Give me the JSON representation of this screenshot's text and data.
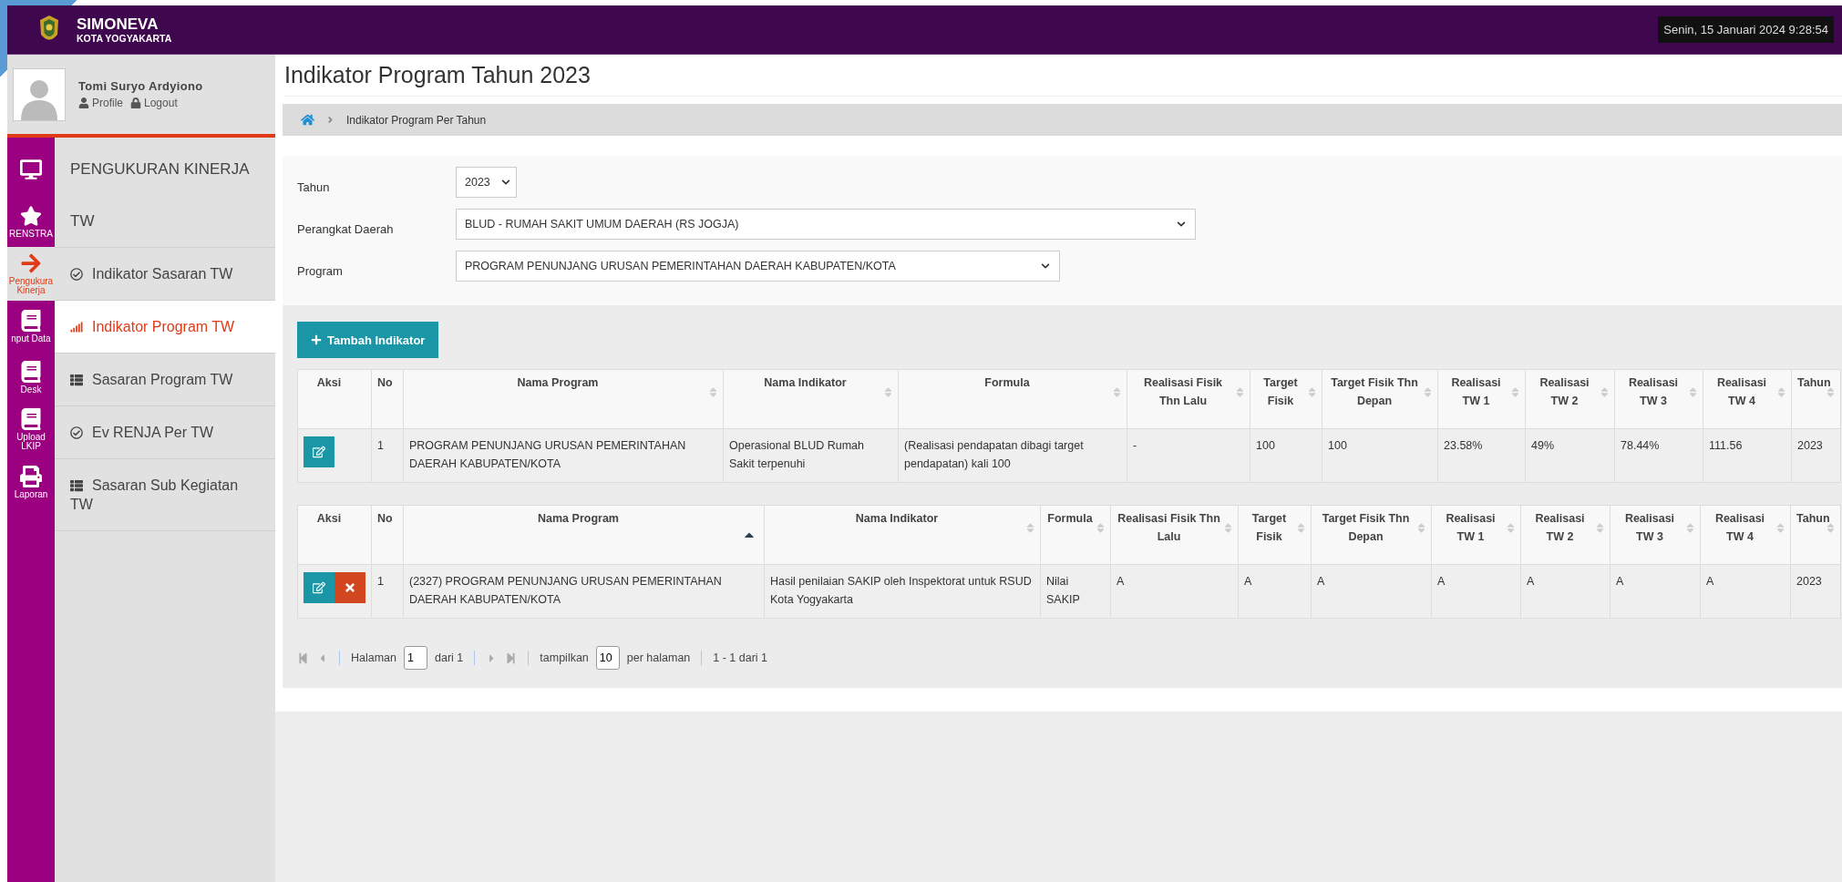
{
  "header": {
    "title": "SIMONEVA",
    "subtitle": "KOTA YOGYAKARTA",
    "datetime": "Senin, 15 Januari 2024  9:28:54"
  },
  "user": {
    "name": "Tomi Suryo Ardyiono",
    "links": [
      {
        "kind": "person",
        "label": "Profile"
      },
      {
        "kind": "lock",
        "label": "Logout"
      }
    ]
  },
  "rail": [
    {
      "kind": "monitor",
      "selected": false
    },
    {
      "kind": "star",
      "lines": [
        "RENSTRA"
      ],
      "selected": false
    },
    {
      "kind": "arrow",
      "lines": [
        "Pengukura",
        "Kinerja"
      ],
      "selected": true
    },
    {
      "kind": "book",
      "lines": [
        "nput Data"
      ],
      "selected": false
    },
    {
      "kind": "book",
      "lines": [
        "Desk"
      ],
      "selected": false
    },
    {
      "kind": "book",
      "lines": [
        "Upload",
        "LKIP"
      ],
      "selected": false
    },
    {
      "kind": "printer",
      "lines": [
        "Laporan"
      ],
      "selected": false
    }
  ],
  "menu": {
    "heading": [
      "PENGUKURAN KINERJA",
      "TW"
    ],
    "items": [
      {
        "kind": "check",
        "label": "Indikator Sasaran TW",
        "selected": false
      },
      {
        "kind": "signal",
        "label": "Indikator Program TW",
        "selected": true
      },
      {
        "kind": "list",
        "label": "Sasaran Program TW",
        "selected": false
      },
      {
        "kind": "check",
        "label": "Ev RENJA Per TW",
        "selected": false
      },
      {
        "kind": "list",
        "label": "Sasaran Sub Kegiatan TW",
        "selected": false
      }
    ]
  },
  "page": {
    "title": "Indikator Program Tahun 2023",
    "breadcrumb": [
      "Indikator Program Per Tahun"
    ]
  },
  "filters": [
    {
      "label": "Tahun",
      "value": "2023"
    },
    {
      "label": "Perangkat Daerah",
      "value": "BLUD - RUMAH SAKIT UMUM DAERAH (RS JOGJA)"
    },
    {
      "label": "Program",
      "value": "PROGRAM PENUNJANG URUSAN PEMERINTAHAN DAERAH KABUPATEN/KOTA"
    }
  ],
  "add_button": "Tambah Indikator",
  "tables": [
    {
      "columns": [
        {
          "label": "Aksi",
          "sortable": false,
          "sorted": false
        },
        {
          "label": "No",
          "sortable": false,
          "sorted": false
        },
        {
          "label": "Nama Program",
          "sortable": true,
          "sorted": false
        },
        {
          "label": "Nama Indikator",
          "sortable": true,
          "sorted": false
        },
        {
          "label": "Formula",
          "sortable": true,
          "sorted": false
        },
        {
          "label": "Realisasi Fisik Thn Lalu",
          "sortable": true,
          "sorted": false
        },
        {
          "label": "Target Fisik",
          "sortable": true,
          "sorted": false
        },
        {
          "label": "Target Fisik Thn Depan",
          "sortable": true,
          "sorted": false
        },
        {
          "label": "Realisasi TW 1",
          "sortable": true,
          "sorted": false
        },
        {
          "label": "Realisasi TW 2",
          "sortable": true,
          "sorted": false
        },
        {
          "label": "Realisasi TW 3",
          "sortable": true,
          "sorted": false
        },
        {
          "label": "Realisasi TW 4",
          "sortable": true,
          "sorted": false
        },
        {
          "label": "Tahun",
          "sortable": true,
          "sorted": false
        }
      ],
      "rows": [
        {
          "cells": [
            {
              "buttons": [
                {
                  "kind": "edit"
                }
              ]
            },
            "1",
            "PROGRAM PENUNJANG URUSAN PEMERINTAHAN DAERAH KABUPATEN/KOTA",
            "Operasional BLUD Rumah Sakit terpenuhi",
            "(Realisasi pendapatan dibagi target pendapatan) kali 100",
            "-",
            "100",
            "100",
            "23.58%",
            "49%",
            "78.44%",
            "111.56",
            "2023"
          ]
        }
      ]
    },
    {
      "columns": [
        {
          "label": "Aksi",
          "sortable": false,
          "sorted": false
        },
        {
          "label": "No",
          "sortable": false,
          "sorted": false
        },
        {
          "label": "Nama Program",
          "sortable": true,
          "sorted": true
        },
        {
          "label": "Nama Indikator",
          "sortable": true,
          "sorted": false
        },
        {
          "label": "Formula",
          "sortable": true,
          "sorted": false
        },
        {
          "label": "Realisasi Fisik Thn Lalu",
          "sortable": true,
          "sorted": false
        },
        {
          "label": "Target Fisik",
          "sortable": true,
          "sorted": false
        },
        {
          "label": "Target Fisik Thn Depan",
          "sortable": true,
          "sorted": false
        },
        {
          "label": "Realisasi TW 1",
          "sortable": true,
          "sorted": false
        },
        {
          "label": "Realisasi TW 2",
          "sortable": true,
          "sorted": false
        },
        {
          "label": "Realisasi TW 3",
          "sortable": true,
          "sorted": false
        },
        {
          "label": "Realisasi TW 4",
          "sortable": true,
          "sorted": false
        },
        {
          "label": "Tahun",
          "sortable": true,
          "sorted": false
        }
      ],
      "rows": [
        {
          "cells": [
            {
              "buttons": [
                {
                  "kind": "edit"
                },
                {
                  "kind": "delete"
                }
              ]
            },
            "1",
            "(2327) PROGRAM PENUNJANG URUSAN PEMERINTAHAN DAERAH KABUPATEN/KOTA",
            "Hasil penilaian SAKIP oleh Inspektorat untuk RSUD Kota Yogyakarta",
            "Nilai SAKIP",
            "A",
            "A",
            "A",
            "A",
            "A",
            "A",
            "A",
            "2023"
          ]
        }
      ]
    }
  ],
  "pagination": {
    "page_label": "Halaman",
    "page": "1",
    "of": "dari 1",
    "show_label": "tampilkan",
    "per_page": "10",
    "per_page_suffix": "per halaman",
    "summary": "1 - 1 dari 1"
  }
}
